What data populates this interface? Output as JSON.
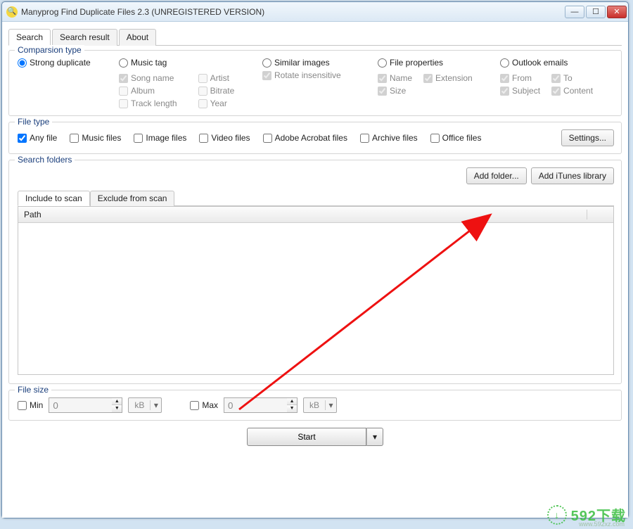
{
  "window": {
    "title": "Manyprog Find Duplicate Files 2.3 (UNREGISTERED VERSION)"
  },
  "tabs": {
    "search": "Search",
    "search_result": "Search result",
    "about": "About"
  },
  "comparison": {
    "legend": "Comparsion type",
    "strong": "Strong duplicate",
    "music": "Music tag",
    "song_name": "Song name",
    "artist": "Artist",
    "album": "Album",
    "bitrate": "Bitrate",
    "track_length": "Track length",
    "year": "Year",
    "similar": "Similar images",
    "rotate": "Rotate insensitive",
    "file_props": "File properties",
    "name": "Name",
    "extension": "Extension",
    "size": "Size",
    "outlook": "Outlook emails",
    "from": "From",
    "to": "To",
    "subject": "Subject",
    "content": "Content"
  },
  "file_type": {
    "legend": "File type",
    "any": "Any file",
    "music": "Music files",
    "image": "Image files",
    "video": "Video files",
    "adobe": "Adobe Acrobat files",
    "archive": "Archive files",
    "office": "Office files",
    "settings": "Settings..."
  },
  "search_folders": {
    "legend": "Search folders",
    "add_folder": "Add folder...",
    "add_itunes": "Add iTunes library",
    "include_tab": "Include to scan",
    "exclude_tab": "Exclude from scan",
    "path_col": "Path"
  },
  "file_size": {
    "legend": "File size",
    "min": "Min",
    "max": "Max",
    "min_value": "0",
    "max_value": "0",
    "unit": "kB"
  },
  "start": "Start",
  "watermark": {
    "text": "592下载",
    "sub": "www.592xz.com"
  }
}
